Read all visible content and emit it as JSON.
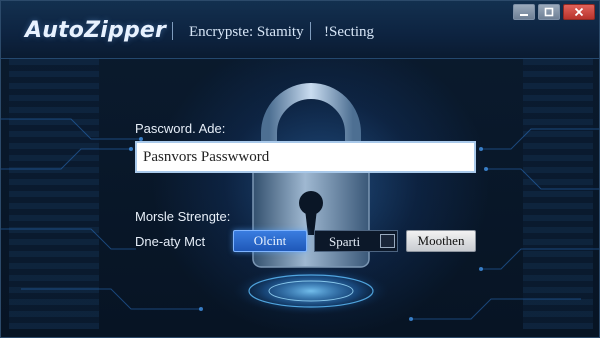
{
  "window": {
    "app_title": "AutoZipper",
    "menu": [
      "Encrypste: Stamity",
      "!Secting"
    ]
  },
  "form": {
    "password_label": "Pascword. Ade:",
    "password_value": "Pasnvors Passwword",
    "strength_label": "Morsle Strengte:",
    "mode_label": "Dne-aty Mct",
    "primary_button": "Olcint",
    "toggle_label": "Sparti",
    "secondary_button": "Moothen"
  },
  "colors": {
    "accent": "#2f6fd6",
    "background": "#07172b",
    "close_button": "#c9403a"
  },
  "icons": [
    "minimize-icon",
    "maximize-icon",
    "close-icon",
    "padlock-illustration"
  ]
}
